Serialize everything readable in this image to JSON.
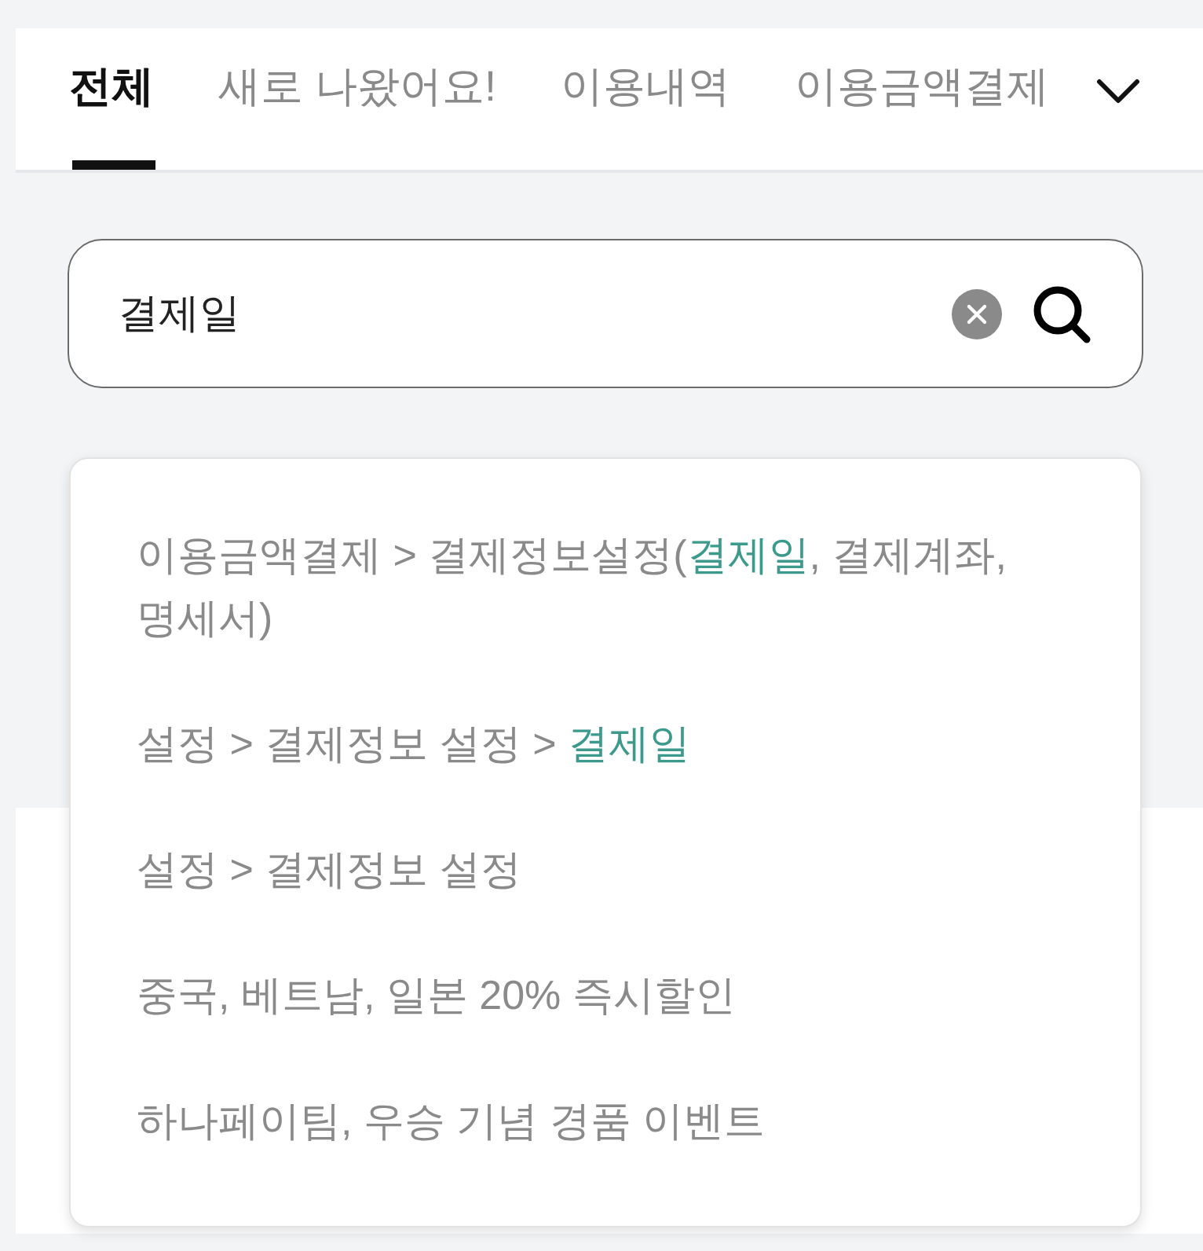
{
  "tabs": [
    {
      "label": "전체",
      "selected": true
    },
    {
      "label": "새로 나왔어요!",
      "selected": false
    },
    {
      "label": "이용내역",
      "selected": false
    },
    {
      "label": "이용금액결제",
      "selected": false
    }
  ],
  "search": {
    "value": "결제일"
  },
  "suggestions": [
    {
      "segments": [
        {
          "text": "이용금액결제 > 결제정보설정(",
          "highlighted": false
        },
        {
          "text": "결제일",
          "highlighted": true
        },
        {
          "text": ", 결제계좌, 명세서)",
          "highlighted": false
        }
      ]
    },
    {
      "segments": [
        {
          "text": "설정 > 결제정보 설정 > ",
          "highlighted": false
        },
        {
          "text": "결제일",
          "highlighted": true
        }
      ]
    },
    {
      "segments": [
        {
          "text": "설정 > 결제정보 설정",
          "highlighted": false
        }
      ]
    },
    {
      "segments": [
        {
          "text": "중국, 베트남, 일본 20% 즉시할인",
          "highlighted": false
        }
      ]
    },
    {
      "segments": [
        {
          "text": "하나페이팀, 우승 기념 경품 이벤트",
          "highlighted": false
        }
      ]
    }
  ]
}
